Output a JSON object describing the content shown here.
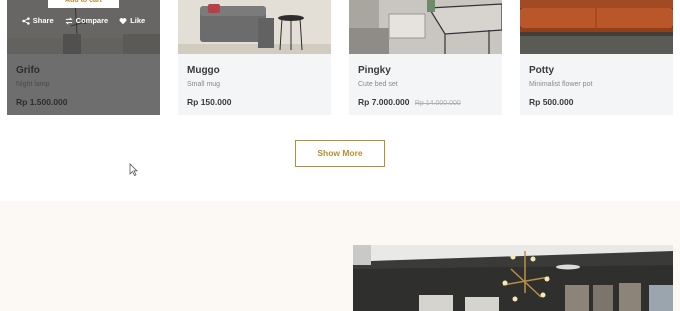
{
  "products": [
    {
      "name": "Grifo",
      "description": "Night lamp",
      "price": "Rp 1.500.000",
      "old_price": ""
    },
    {
      "name": "Muggo",
      "description": "Small mug",
      "price": "Rp 150.000",
      "old_price": ""
    },
    {
      "name": "Pingky",
      "description": "Cute bed set",
      "price": "Rp 7.000.000",
      "old_price": "Rp 14.000.000"
    },
    {
      "name": "Potty",
      "description": "Minimalist flower pot",
      "price": "Rp 500.000",
      "old_price": ""
    }
  ],
  "hover_actions": {
    "add_to_cart": "Add to cart",
    "share": "Share",
    "compare": "Compare",
    "like": "Like"
  },
  "show_more_label": "Show More",
  "colors": {
    "accent": "#b88e2f",
    "card_bg": "#f4f5f7",
    "section_bg": "#fcf8f3",
    "overlay": "#3a3a3a"
  },
  "icons": [
    "share-icon",
    "compare-icon",
    "heart-icon",
    "cursor-icon"
  ]
}
